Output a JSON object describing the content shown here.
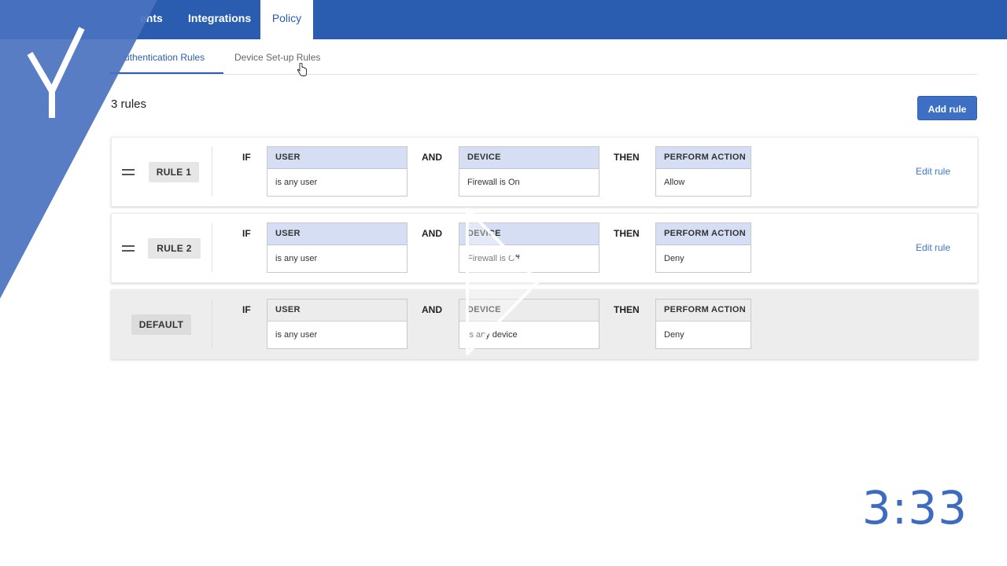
{
  "topnav": {
    "tabs": [
      {
        "label": "ents"
      },
      {
        "label": "Integrations"
      },
      {
        "label": "Policy"
      }
    ]
  },
  "subtabs": [
    {
      "label": "uthentication Rules"
    },
    {
      "label": "Device Set-up Rules"
    }
  ],
  "rules_count": "3 rules",
  "add_rule_label": "Add rule",
  "keywords": {
    "if": "IF",
    "and": "AND",
    "then": "THEN"
  },
  "rules": [
    {
      "badge": "RULE 1",
      "user": {
        "head": "USER",
        "value": "is any user"
      },
      "device": {
        "head": "DEVICE",
        "value": "Firewall is On"
      },
      "action": {
        "head": "PERFORM ACTION",
        "value": "Allow"
      },
      "edit": "Edit rule"
    },
    {
      "badge": "RULE 2",
      "user": {
        "head": "USER",
        "value": "is any user"
      },
      "device": {
        "head": "DEVICE",
        "value": "Firewall is Off"
      },
      "action": {
        "head": "PERFORM ACTION",
        "value": "Deny"
      },
      "edit": "Edit rule"
    },
    {
      "badge": "DEFAULT",
      "user": {
        "head": "USER",
        "value": "is any user"
      },
      "device": {
        "head": "DEVICE",
        "value": "is any device"
      },
      "action": {
        "head": "PERFORM ACTION",
        "value": "Deny"
      }
    }
  ],
  "timer": "3:33",
  "colors": {
    "nav": "#2a5db0",
    "accent": "#3d70c4",
    "link": "#3a78c7",
    "cond_header": "#d5def2",
    "brand_overlay": "#4a72c0"
  },
  "icons": [
    "hand-cursor-icon",
    "drag-handle-icon",
    "play-icon",
    "brand-logo-icon"
  ]
}
